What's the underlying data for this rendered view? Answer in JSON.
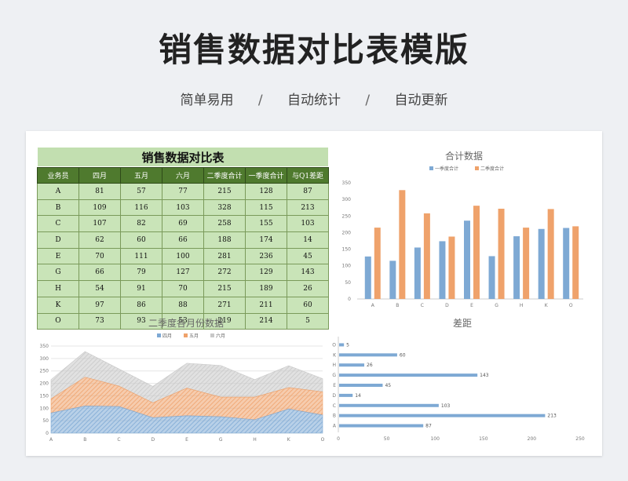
{
  "header": {
    "title": "销售数据对比表模版",
    "features": [
      "简单易用",
      "自动统计",
      "自动更新"
    ],
    "separator": "/"
  },
  "table": {
    "title": "销售数据对比表",
    "columns": [
      "业务员",
      "四月",
      "五月",
      "六月",
      "二季度合计",
      "一季度合计",
      "与Q1差距"
    ],
    "rows": [
      [
        "A",
        "81",
        "57",
        "77",
        "215",
        "128",
        "87"
      ],
      [
        "B",
        "109",
        "116",
        "103",
        "328",
        "115",
        "213"
      ],
      [
        "C",
        "107",
        "82",
        "69",
        "258",
        "155",
        "103"
      ],
      [
        "D",
        "62",
        "60",
        "66",
        "188",
        "174",
        "14"
      ],
      [
        "E",
        "70",
        "111",
        "100",
        "281",
        "236",
        "45"
      ],
      [
        "G",
        "66",
        "79",
        "127",
        "272",
        "129",
        "143"
      ],
      [
        "H",
        "54",
        "91",
        "70",
        "215",
        "189",
        "26"
      ],
      [
        "K",
        "97",
        "86",
        "88",
        "271",
        "211",
        "60"
      ],
      [
        "O",
        "73",
        "93",
        "53",
        "219",
        "214",
        "5"
      ]
    ]
  },
  "colors": {
    "blue": "#7ea9d4",
    "orange": "#efa26b",
    "gray": "#c8c8c8",
    "header_green": "#4f7a2e",
    "cell_green": "#c9e4b8"
  },
  "chart_data": [
    {
      "type": "bar",
      "title": "合计数据",
      "categories": [
        "A",
        "B",
        "C",
        "D",
        "E",
        "G",
        "H",
        "K",
        "O"
      ],
      "series": [
        {
          "name": "一季度合计",
          "values": [
            128,
            115,
            155,
            174,
            236,
            129,
            189,
            211,
            214
          ]
        },
        {
          "name": "二季度合计",
          "values": [
            215,
            328,
            258,
            188,
            281,
            272,
            215,
            271,
            219
          ]
        }
      ],
      "ylim": [
        0,
        350
      ],
      "yticks": [
        0,
        50,
        100,
        150,
        200,
        250,
        300,
        350
      ],
      "legend": "top",
      "grid": false
    },
    {
      "type": "area",
      "stacked": true,
      "title": "二季度各月份数据",
      "categories": [
        "A",
        "B",
        "C",
        "D",
        "E",
        "G",
        "H",
        "K",
        "O"
      ],
      "series": [
        {
          "name": "四月",
          "values": [
            81,
            109,
            107,
            62,
            70,
            66,
            54,
            97,
            73
          ]
        },
        {
          "name": "五月",
          "values": [
            57,
            116,
            82,
            60,
            111,
            79,
            91,
            86,
            93
          ]
        },
        {
          "name": "六月",
          "values": [
            77,
            103,
            69,
            66,
            100,
            127,
            70,
            88,
            53
          ]
        }
      ],
      "ylim": [
        0,
        350
      ],
      "yticks": [
        0,
        50,
        100,
        150,
        200,
        250,
        300,
        350
      ],
      "legend": "top",
      "grid": true
    },
    {
      "type": "bar",
      "orientation": "horizontal",
      "title": "差距",
      "categories": [
        "A",
        "B",
        "C",
        "D",
        "E",
        "G",
        "H",
        "K",
        "O"
      ],
      "values": [
        87,
        213,
        103,
        14,
        45,
        143,
        26,
        60,
        5
      ],
      "xlim": [
        0,
        250
      ],
      "xticks": [
        0,
        50,
        100,
        150,
        200,
        250
      ],
      "data_labels": true
    }
  ]
}
